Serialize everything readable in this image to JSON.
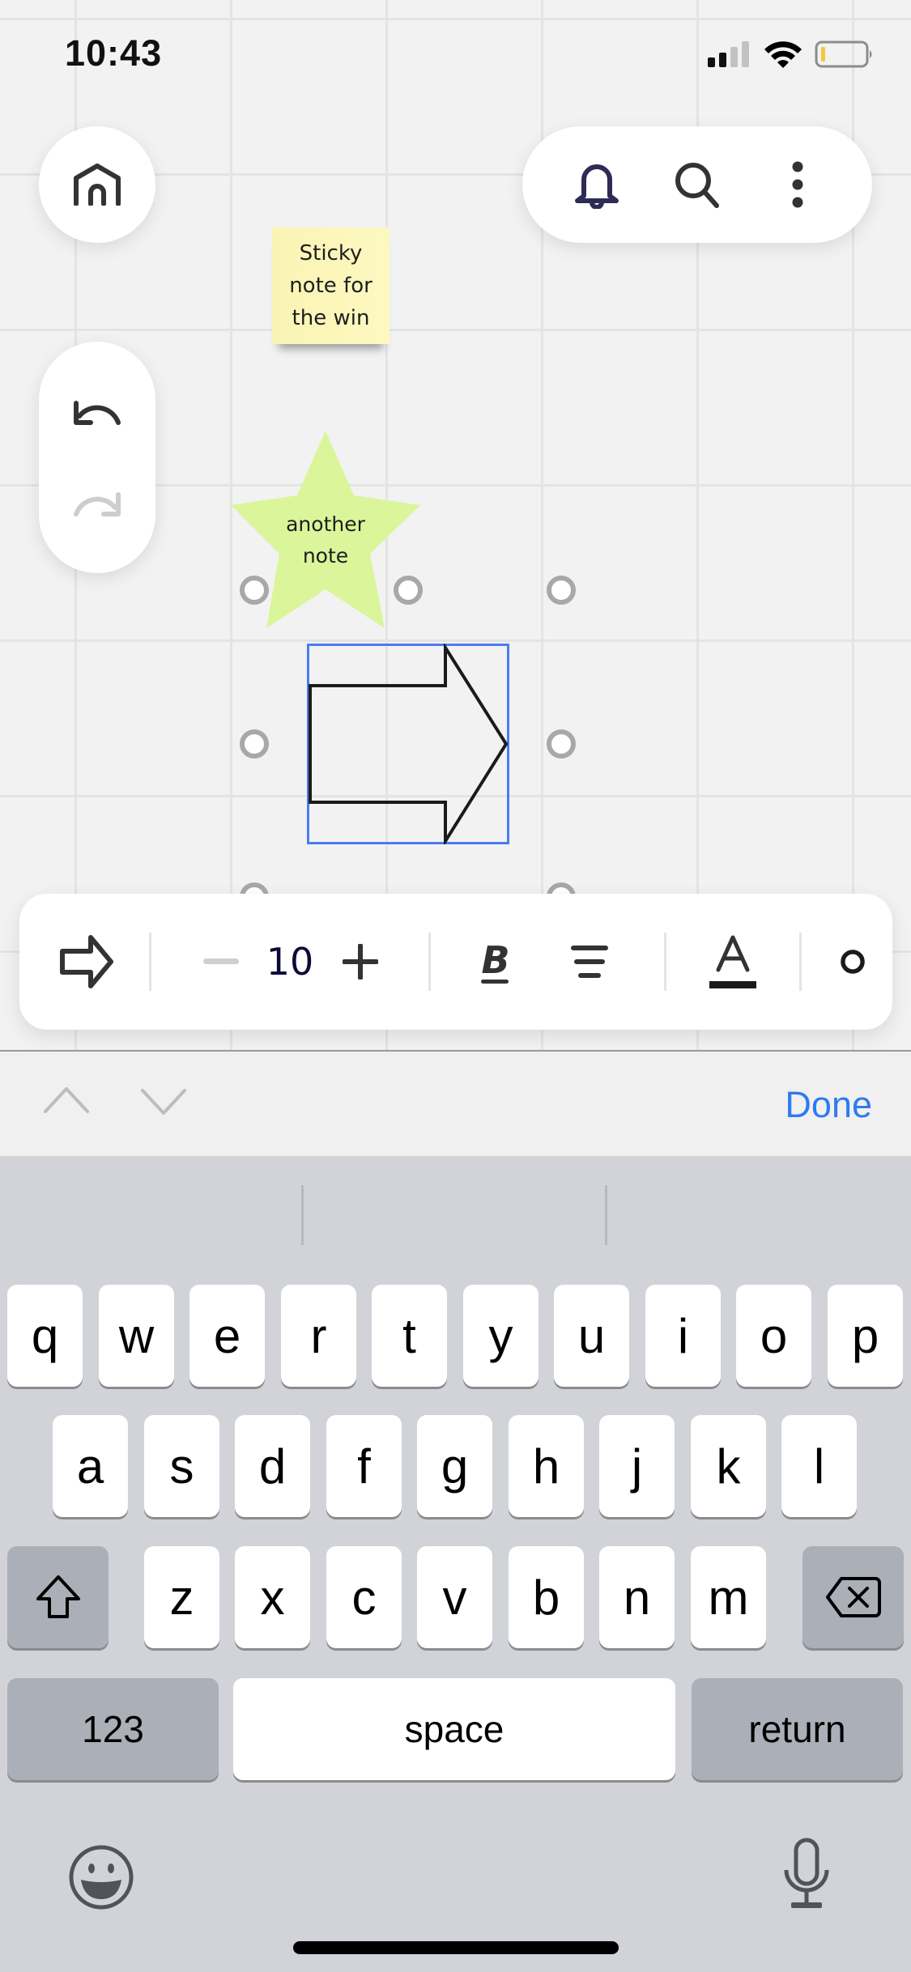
{
  "status_bar": {
    "time": "10:43",
    "signal_icon": "cellular-signal-icon",
    "wifi_icon": "wifi-icon",
    "battery_icon": "battery-low-icon"
  },
  "nav": {
    "home_icon": "home-icon",
    "undo_icon": "undo-icon",
    "redo_icon": "redo-icon",
    "notifications_icon": "bell-icon",
    "search_icon": "search-icon",
    "more_icon": "more-vertical-icon"
  },
  "board": {
    "sticky_note": {
      "lines": [
        "Sticky",
        "note for",
        "the win"
      ],
      "color": "#fcf6b8"
    },
    "star_shape": {
      "lines": [
        "another",
        "note"
      ],
      "color": "#dbf59a"
    },
    "selected_shape": {
      "type": "right-arrow",
      "selection_color": "#4a7cf0"
    }
  },
  "format_toolbar": {
    "shape_icon": "arrow-shape-icon",
    "decrease_icon": "minus-icon",
    "font_size": "10",
    "increase_icon": "plus-icon",
    "bold_icon": "bold-icon",
    "align_icon": "align-center-icon",
    "text_color_icon": "text-color-icon",
    "border_icon": "border-color-icon"
  },
  "accessory_bar": {
    "prev_icon": "chevron-up-icon",
    "next_icon": "chevron-down-icon",
    "done_label": "Done",
    "done_color": "#2f7bef"
  },
  "keyboard": {
    "row1": [
      "q",
      "w",
      "e",
      "r",
      "t",
      "y",
      "u",
      "i",
      "o",
      "p"
    ],
    "row2": [
      "a",
      "s",
      "d",
      "f",
      "g",
      "h",
      "j",
      "k",
      "l"
    ],
    "row3": [
      "z",
      "x",
      "c",
      "v",
      "b",
      "n",
      "m"
    ],
    "shift_icon": "shift-icon",
    "delete_icon": "delete-icon",
    "numbers_label": "123",
    "space_label": "space",
    "return_label": "return",
    "emoji_icon": "emoji-icon",
    "dictation_icon": "microphone-icon"
  }
}
